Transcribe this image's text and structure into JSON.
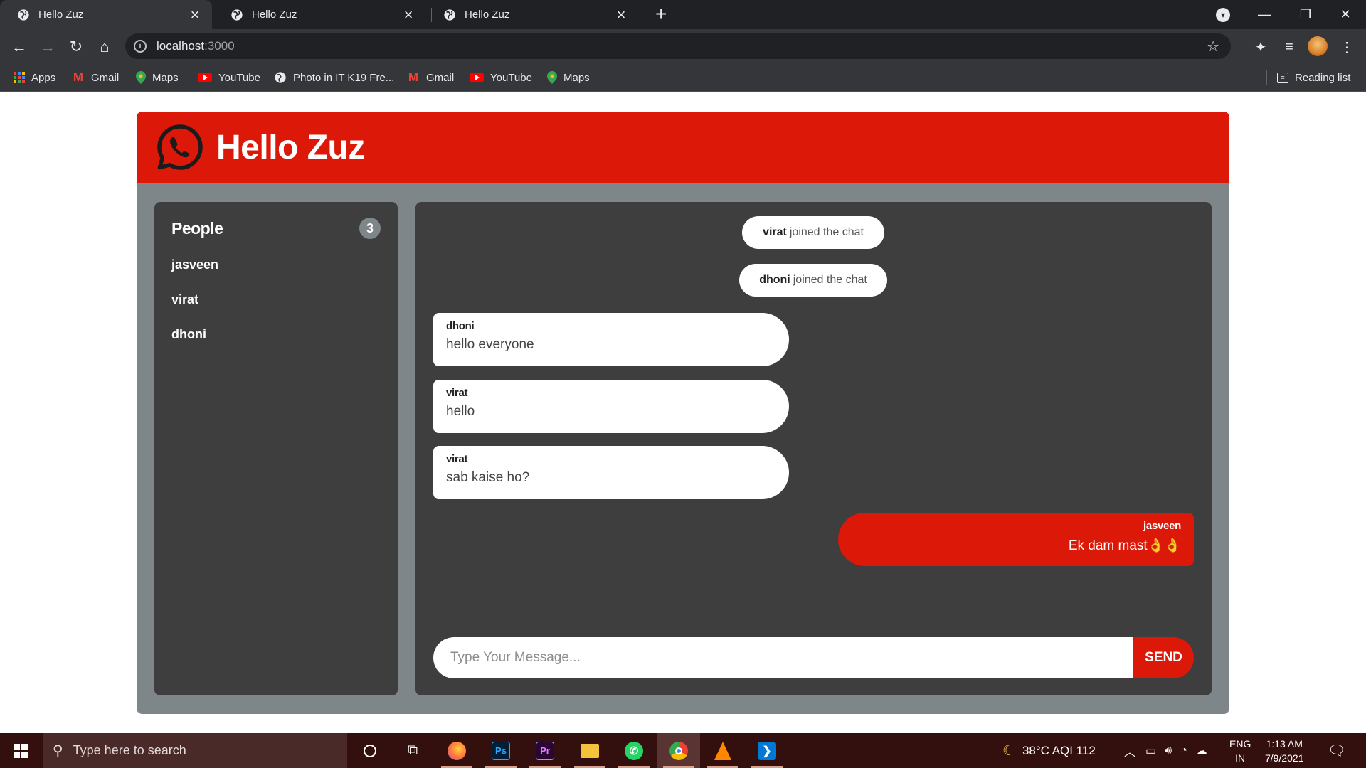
{
  "browser": {
    "tabs": [
      {
        "title": "Hello Zuz",
        "active": true
      },
      {
        "title": "Hello Zuz",
        "active": false
      },
      {
        "title": "Hello Zuz",
        "active": false
      }
    ],
    "url_host": "localhost",
    "url_port": ":3000",
    "bookmarks": [
      {
        "label": "Apps",
        "icon": "apps-grid-icon"
      },
      {
        "label": "Gmail",
        "icon": "gmail-icon"
      },
      {
        "label": "Maps",
        "icon": "maps-pin-icon"
      },
      {
        "label": "YouTube",
        "icon": "youtube-icon"
      },
      {
        "label": "Photo in IT K19 Fre...",
        "icon": "globe-icon"
      },
      {
        "label": "Gmail",
        "icon": "gmail-icon"
      },
      {
        "label": "YouTube",
        "icon": "youtube-icon"
      },
      {
        "label": "Maps",
        "icon": "maps-pin-icon"
      }
    ],
    "reading_list": "Reading list"
  },
  "app": {
    "title": "Hello Zuz",
    "brand_color": "#dc1808",
    "people": {
      "title": "People",
      "count": "3",
      "members": [
        "jasveen",
        "virat",
        "dhoni"
      ]
    },
    "notices": [
      {
        "user": "virat",
        "text": "joined the chat"
      },
      {
        "user": "dhoni",
        "text": "joined the chat"
      }
    ],
    "messages": [
      {
        "user": "dhoni",
        "text": "hello everyone",
        "mine": false
      },
      {
        "user": "virat",
        "text": "hello",
        "mine": false
      },
      {
        "user": "virat",
        "text": "sab kaise ho?",
        "mine": false
      },
      {
        "user": "jasveen",
        "text": "Ek dam mast👌👌",
        "mine": true
      }
    ],
    "composer": {
      "placeholder": "Type Your Message...",
      "send_label": "SEND"
    }
  },
  "taskbar": {
    "search_placeholder": "Type here to search",
    "weather": "38°C  AQI 112",
    "language": "ENG",
    "region": "IN",
    "time": "1:13 AM",
    "date": "7/9/2021"
  }
}
